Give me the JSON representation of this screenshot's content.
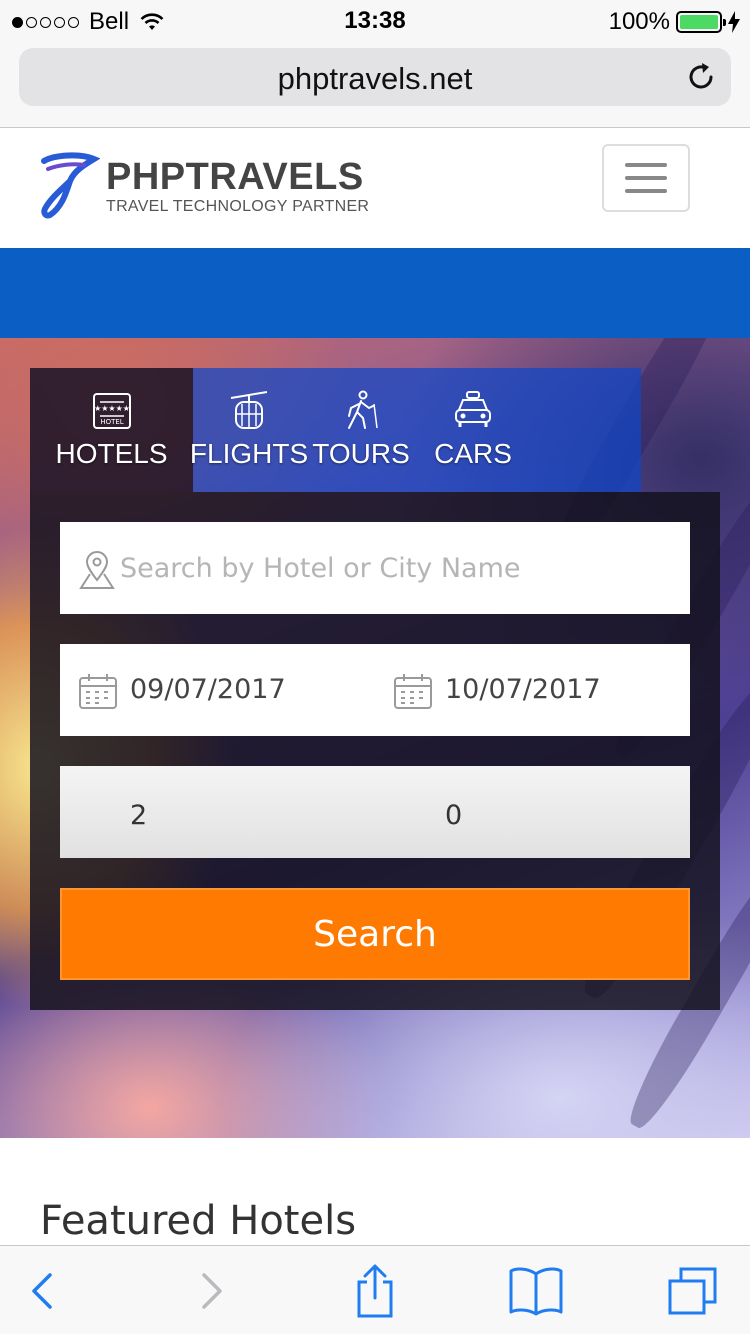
{
  "status_bar": {
    "carrier": "Bell",
    "time": "13:38",
    "battery_percent": "100%",
    "battery_level": 1.0,
    "signal_bars_filled": 1,
    "signal_bars_total": 5
  },
  "browser": {
    "url": "phptravels.net"
  },
  "site": {
    "logo_title": "PHPTRAVELS",
    "logo_subtitle": "TRAVEL TECHNOLOGY PARTNER",
    "accent_blue": "#0b5fc4",
    "accent_orange": "#ff7a00"
  },
  "tabs": [
    {
      "label": "HOTELS",
      "icon": "hotel-icon",
      "active": true
    },
    {
      "label": "FLIGHTS",
      "icon": "cable-car-icon",
      "active": false
    },
    {
      "label": "TOURS",
      "icon": "hiker-icon",
      "active": false
    },
    {
      "label": "CARS",
      "icon": "taxi-icon",
      "active": false
    }
  ],
  "search_form": {
    "location_placeholder": "Search by Hotel or City Name",
    "location_value": "",
    "checkin": "09/07/2017",
    "checkout": "10/07/2017",
    "adults": "2",
    "children": "0",
    "search_label": "Search"
  },
  "featured": {
    "title": "Featured Hotels"
  }
}
